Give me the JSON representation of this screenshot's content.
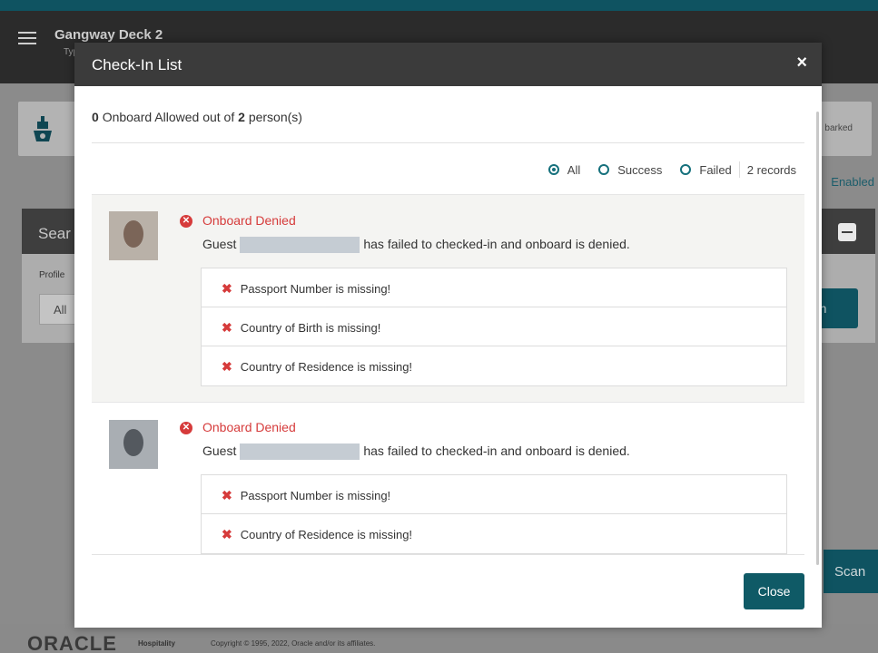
{
  "app": {
    "title": "Gangway Deck 2",
    "subtitle": "Typ",
    "card_right_text": "barked",
    "enabled_text": "Enabled",
    "search_header": "Sear",
    "profile_label": "Profile",
    "profile_value": "All",
    "search_button": "rch",
    "scan_button": "Scan",
    "colors": {
      "accent": "#0f5361",
      "header": "#2b2b2b",
      "denied": "#d63b3b"
    }
  },
  "footer": {
    "brand": "ORACLE",
    "brand_suffix": "Hospitality",
    "copyright": "Copyright © 1995, 2022, Oracle and/or its affiliates."
  },
  "modal": {
    "title": "Check-In List",
    "close_icon": "×",
    "summary": {
      "allowed": "0",
      "text_mid": "Onboard Allowed out of",
      "total": "2",
      "text_end": "person(s)"
    },
    "filters": {
      "options": [
        "All",
        "Success",
        "Failed"
      ],
      "selected": "All",
      "record_count": "2 records"
    },
    "records": [
      {
        "status": "Onboard Denied",
        "guest_prefix": "Guest",
        "message": "has failed to checked-in and onboard is denied.",
        "errors": [
          "Passport Number is missing!",
          "Country of Birth is missing!",
          "Country of Residence is missing!"
        ]
      },
      {
        "status": "Onboard Denied",
        "guest_prefix": "Guest",
        "message": "has failed to checked-in and onboard is denied.",
        "errors": [
          "Passport Number is missing!",
          "Country of Residence is missing!"
        ]
      }
    ],
    "close_button": "Close"
  }
}
